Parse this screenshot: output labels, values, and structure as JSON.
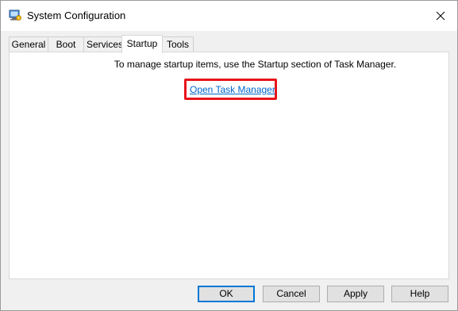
{
  "window": {
    "title": "System Configuration",
    "icon": "system-config-icon",
    "close_icon": "close-icon"
  },
  "tabs": [
    {
      "label": "General"
    },
    {
      "label": "Boot"
    },
    {
      "label": "Services"
    },
    {
      "label": "Startup",
      "active": true
    },
    {
      "label": "Tools"
    }
  ],
  "startup_panel": {
    "instruction": "To manage startup items, use the Startup section of Task Manager.",
    "link_label": "Open Task Manager",
    "highlight_color": "#e8131b",
    "link_color": "#0066cc"
  },
  "buttons": {
    "ok": "OK",
    "cancel": "Cancel",
    "apply": "Apply",
    "help": "Help"
  }
}
